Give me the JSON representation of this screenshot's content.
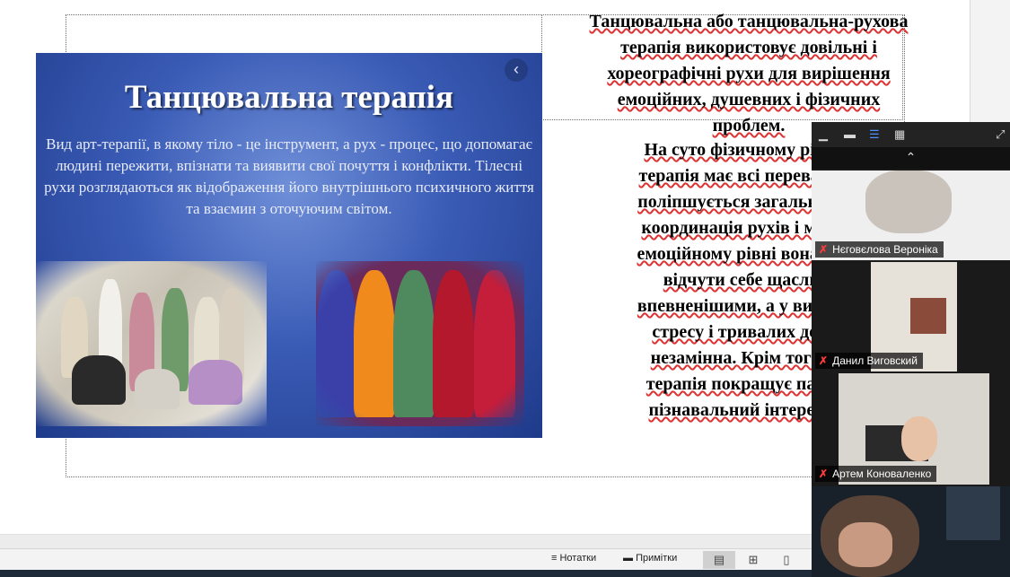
{
  "slide": {
    "picture": {
      "title": "Танцювальна терапія",
      "description": "Вид арт-терапії, в якому тіло - це інструмент, а рух -  процес, що допомагає людині пережити, впізнати та виявити свої почуття і конфлікти. Тілесні рухи розглядаються як відображення його внутрішнього психичного життя  та взаємин з оточуючим світом.",
      "back_glyph": "‹"
    },
    "right_text_1_lines": [
      "Танцювальна або танцювальна-рухова",
      "терапія використовує довільні і",
      "хореографічні рухи для вирішення",
      "емоційних, душевних і фізичних",
      "проблем."
    ],
    "right_text_2_lines": [
      "На суто фізичному рівні т",
      "терапія має всі переваги за",
      "поліпшується загальний ст",
      "координація рухів і м'язов",
      "емоційному рівні вона допо",
      "відчути себе щасливі",
      "впевненішими, а у випадка",
      "стресу і тривалих депре",
      "незамінна. Крім того, та",
      "терапія покращує пам'ят",
      "пізнавальний інтерес і м"
    ]
  },
  "zoom": {
    "toolbar_icons": [
      "minimize-icon",
      "speaker-view-icon",
      "gallery-strip-icon",
      "grid-icon",
      "expand-icon"
    ],
    "chevron_glyph": "⌃",
    "participants": [
      {
        "name": "Нєговєлова Вероніка",
        "muted": true
      },
      {
        "name": "Данил Виговский",
        "muted": true
      },
      {
        "name": "Артем Коноваленко",
        "muted": true
      },
      {
        "name": "",
        "muted": false
      }
    ],
    "mute_glyph": "✗"
  },
  "status_bar": {
    "notes_label": "Нотатки",
    "comments_label": "Примітки",
    "notes_icon": "notes-icon",
    "comments_icon": "comment-icon"
  },
  "colors": {
    "picture_bg": "#3a5bb5",
    "zoom_bg": "#1a1a1a",
    "mute_red": "#ff3b3b"
  }
}
